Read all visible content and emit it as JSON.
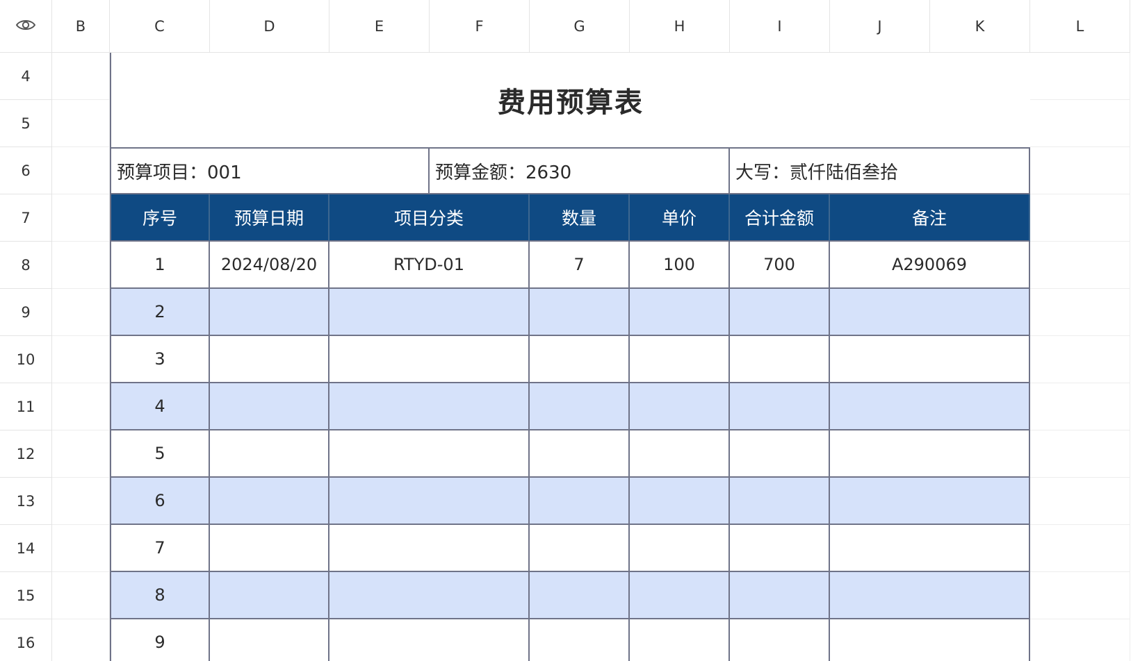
{
  "column_headers": [
    "B",
    "C",
    "D",
    "E",
    "F",
    "G",
    "H",
    "I",
    "J",
    "K",
    "L"
  ],
  "row_headers": [
    "4",
    "5",
    "6",
    "7",
    "8",
    "9",
    "10",
    "11",
    "12",
    "13",
    "14",
    "15",
    "16"
  ],
  "icons": {
    "corner": "eye-icon"
  },
  "colors": {
    "header_fill": "#0f4a83",
    "header_text": "#ffffff",
    "band_fill": "#d6e2fa",
    "table_border": "#6f7388"
  },
  "sheet": {
    "title": "费用预算表",
    "info": {
      "project": "预算项目：001",
      "amount": "预算金额：2630",
      "uppercase": "大写：贰仟陆佰叁拾"
    },
    "table_headers": [
      "序号",
      "预算日期",
      "项目分类",
      "数量",
      "单价",
      "合计金额",
      "备注"
    ],
    "rows": [
      [
        "1",
        "2024/08/20",
        "RTYD-01",
        "7",
        "100",
        "700",
        "A290069"
      ],
      [
        "2",
        "",
        "",
        "",
        "",
        "",
        ""
      ],
      [
        "3",
        "",
        "",
        "",
        "",
        "",
        ""
      ],
      [
        "4",
        "",
        "",
        "",
        "",
        "",
        ""
      ],
      [
        "5",
        "",
        "",
        "",
        "",
        "",
        ""
      ],
      [
        "6",
        "",
        "",
        "",
        "",
        "",
        ""
      ],
      [
        "7",
        "",
        "",
        "",
        "",
        "",
        ""
      ],
      [
        "8",
        "",
        "",
        "",
        "",
        "",
        ""
      ],
      [
        "9",
        "",
        "",
        "",
        "",
        "",
        ""
      ]
    ]
  }
}
